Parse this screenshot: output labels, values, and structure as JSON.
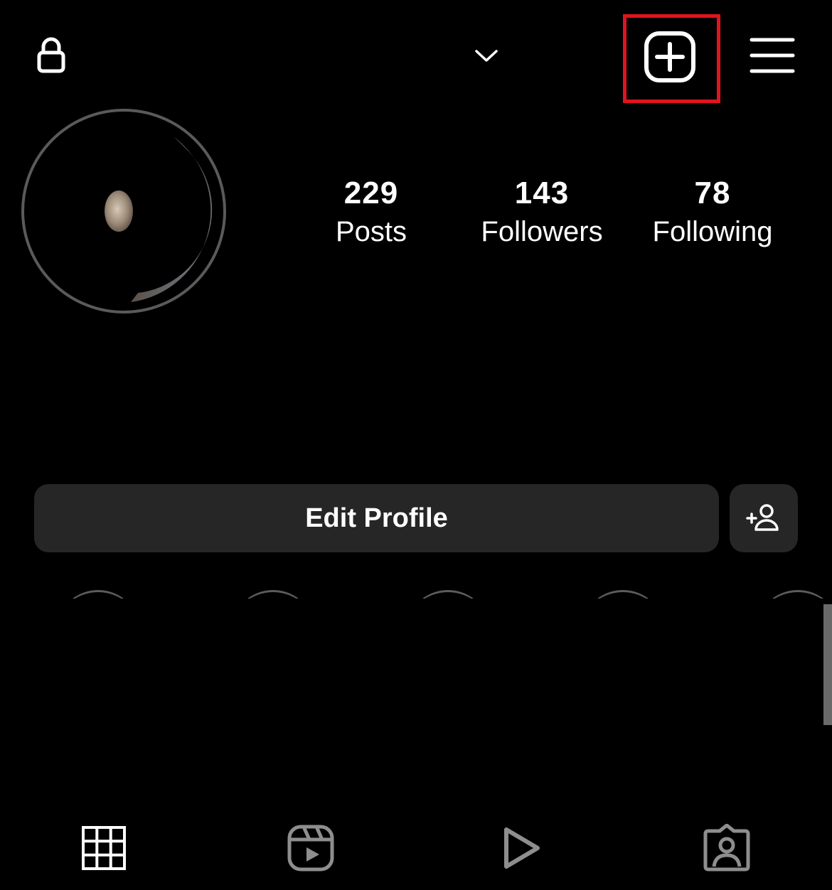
{
  "header": {
    "username": "",
    "icons": {
      "lock": "lock-icon",
      "account_switcher": "chevron-down-icon",
      "create": "plus-square-icon",
      "menu": "hamburger-menu-icon"
    },
    "create_highlight_color": "#e0141e"
  },
  "profile": {
    "avatar": "avatar",
    "stats": [
      {
        "value": "229",
        "label": "Posts"
      },
      {
        "value": "143",
        "label": "Followers"
      },
      {
        "value": "78",
        "label": "Following"
      }
    ]
  },
  "actions": {
    "edit_profile_label": "Edit Profile",
    "discover_people_icon": "add-person-icon"
  },
  "highlights": [
    {
      "label": ""
    },
    {
      "label": ""
    },
    {
      "label": ""
    },
    {
      "label": ""
    },
    {
      "label": ""
    }
  ],
  "tabs": [
    {
      "icon": "grid-icon",
      "active": true
    },
    {
      "icon": "reels-icon",
      "active": false
    },
    {
      "icon": "play-icon",
      "active": false
    },
    {
      "icon": "tagged-icon",
      "active": false
    }
  ],
  "colors": {
    "background": "#000000",
    "button_bg": "#262626",
    "text": "#ffffff",
    "inactive_icon": "#8e8e8e"
  }
}
